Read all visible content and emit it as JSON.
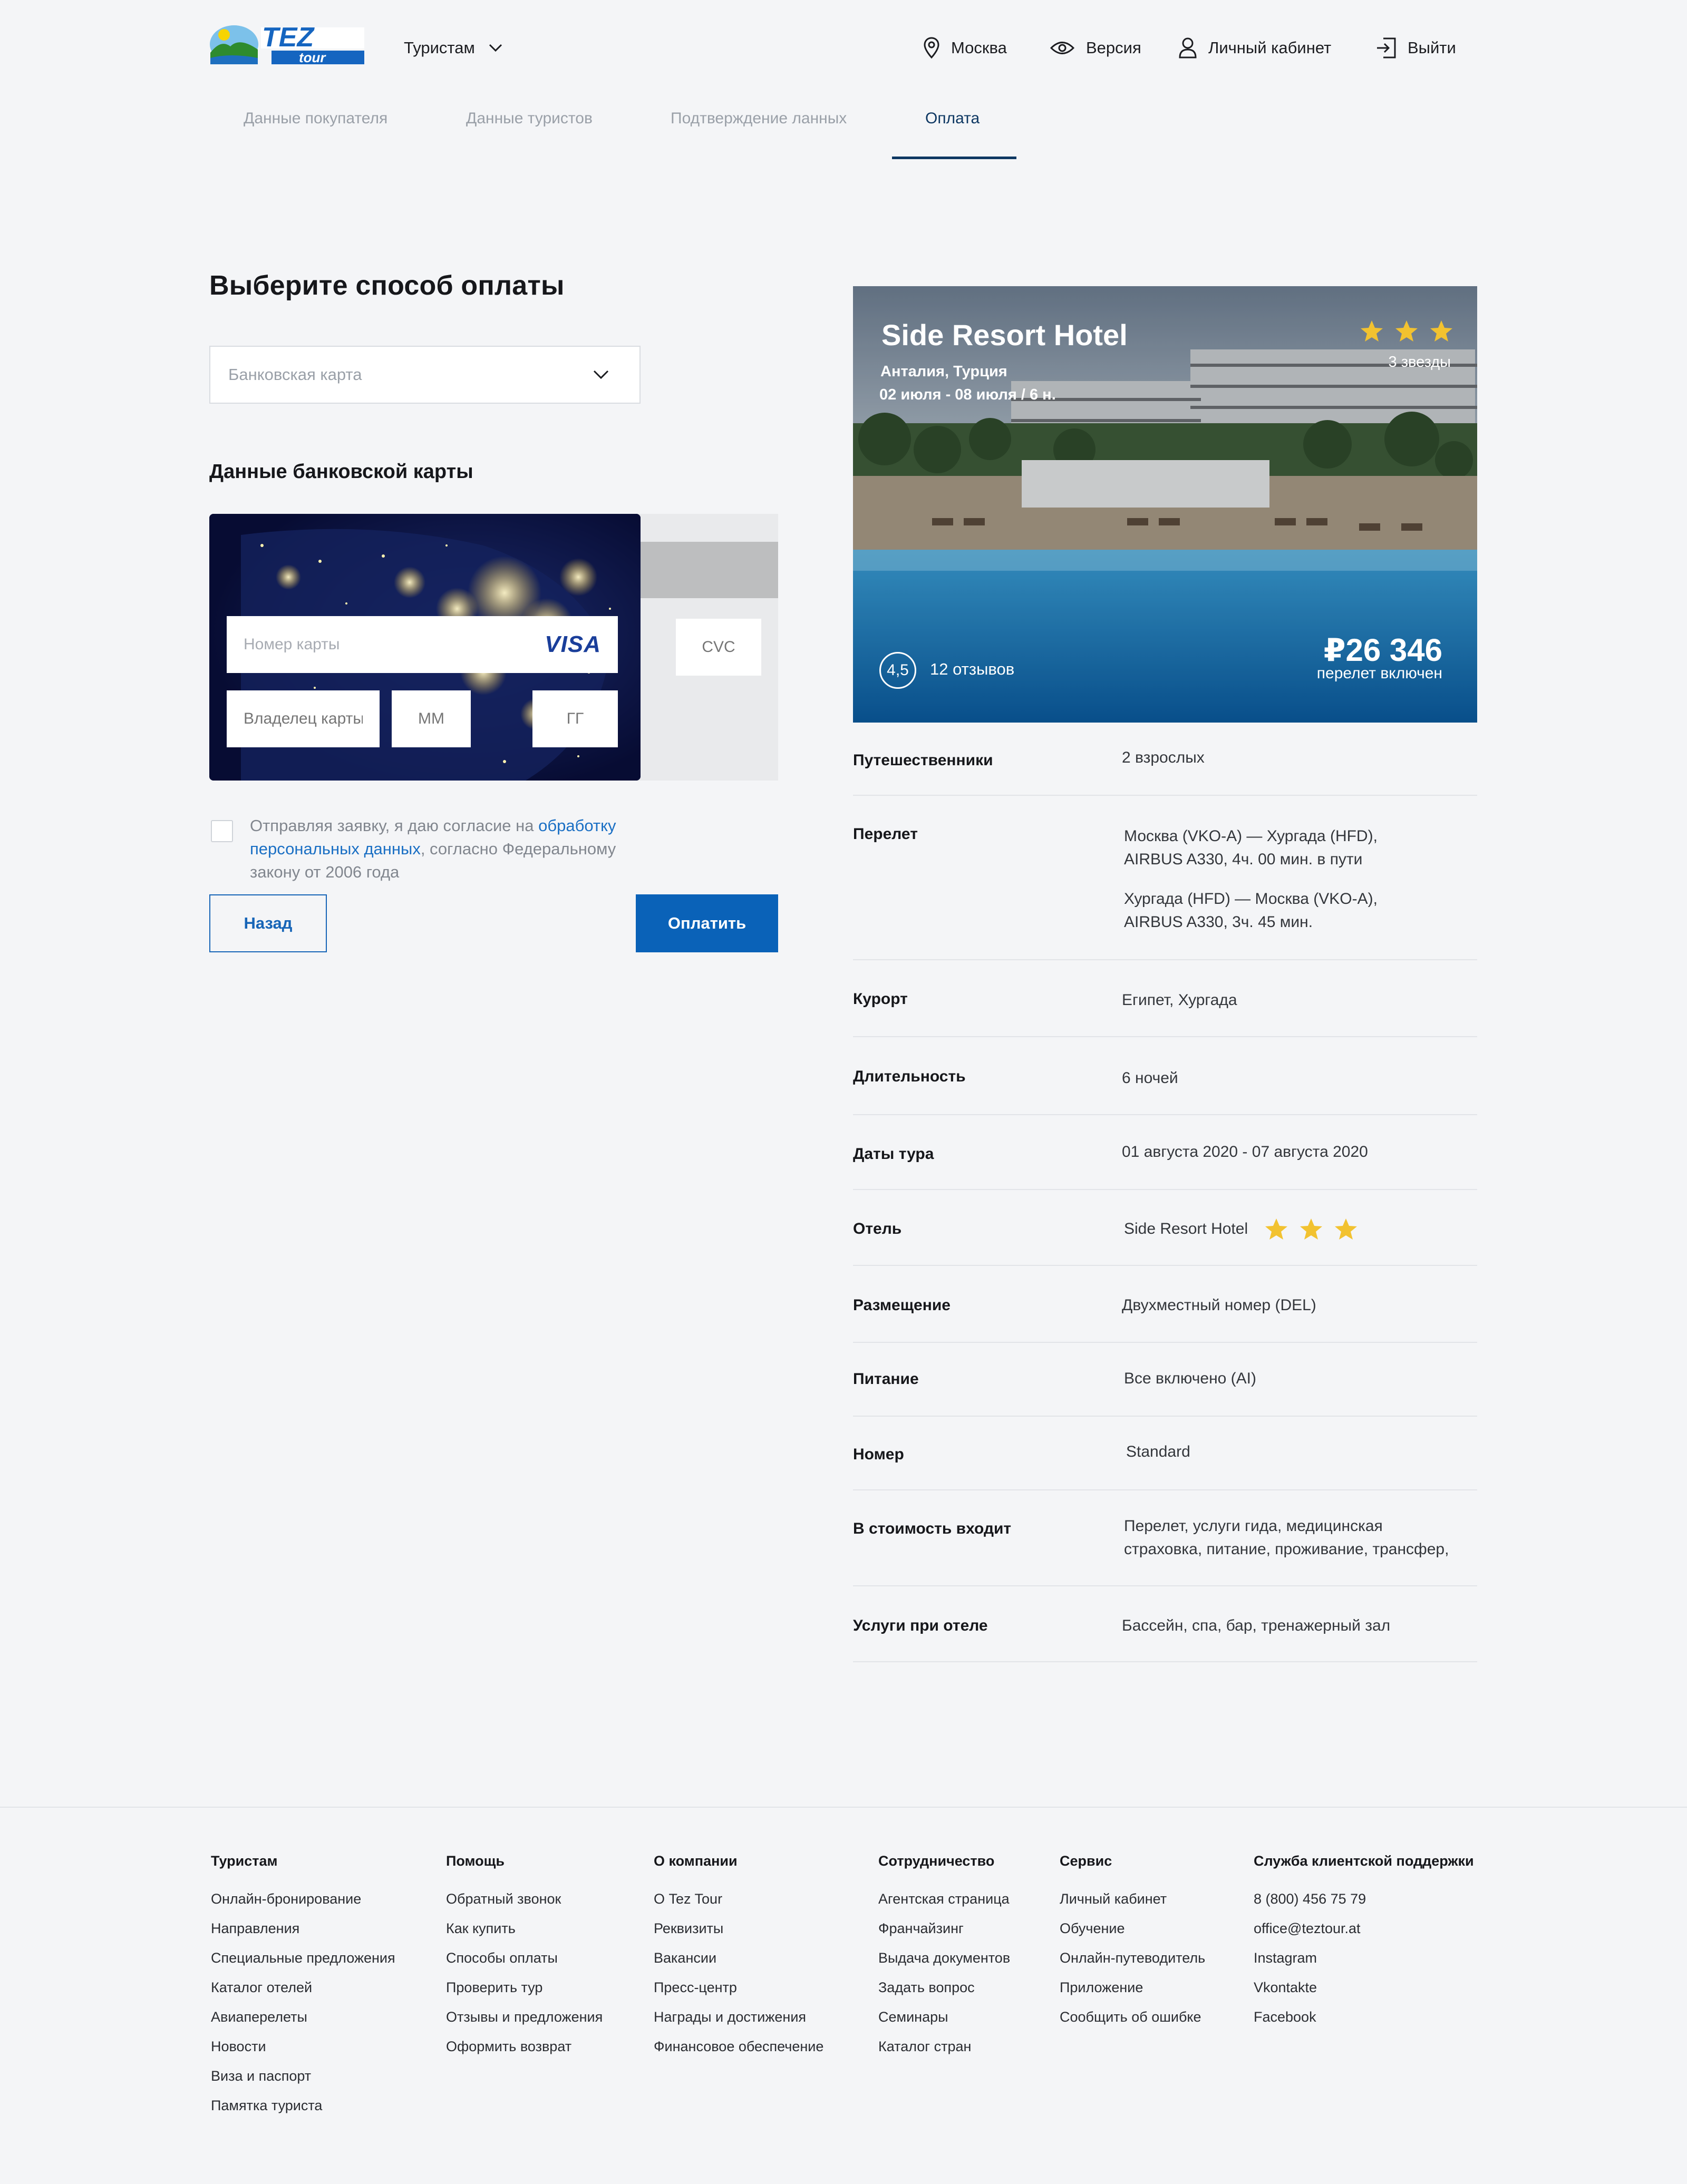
{
  "header": {
    "logo_text_top": "TEZ",
    "logo_text_bottom": "tour",
    "menu": "Туристам",
    "city": "Москва",
    "version": "Версия",
    "account": "Личный кабинет",
    "logout": "Выйти"
  },
  "steps": [
    {
      "label": "Данные покупателя"
    },
    {
      "label": "Данные туристов"
    },
    {
      "label": "Подтверждение ланных"
    },
    {
      "label": "Оплата"
    }
  ],
  "payment": {
    "title": "Выберите способ оплаты",
    "method_placeholder": "Банковская карта",
    "card_section_title": "Данные банковской карты",
    "card_number_placeholder": "Номер карты",
    "card_brand": "VISA",
    "holder_placeholder": "Владелец карты",
    "month_placeholder": "ММ",
    "year_placeholder": "ГГ",
    "cvc_placeholder": "CVC",
    "consent_text_before": "Отправляя заявку, я даю согласие на ",
    "consent_link": "обработку персональных данных",
    "consent_text_after": ", согласно Федеральному закону от 2006 года",
    "back_button": "Назад",
    "pay_button": "Оплатить"
  },
  "hotel": {
    "name": "Side Resort Hotel",
    "location": "Анталия, Турция",
    "dates": "02 июля - 08 июля / 6 н.",
    "stars": 3,
    "stars_label": "3 звезды",
    "rating": "4,5",
    "reviews": "12 отзывов",
    "price": "₽26 346",
    "price_note": "перелет включен"
  },
  "details": {
    "travelers": {
      "label": "Путешественники",
      "value": "2 взрослых"
    },
    "flight": {
      "label": "Перелет",
      "outbound_1": "Москва (VKO-A) — Хургада (HFD),",
      "outbound_2": "AIRBUS A330, 4ч. 00 мин. в пути",
      "return_1": "Хургада (HFD) — Москва (VKO-A),",
      "return_2": "AIRBUS A330, 3ч. 45 мин."
    },
    "resort": {
      "label": "Курорт",
      "value": "Египет, Хургада"
    },
    "duration": {
      "label": "Длительность",
      "value": "6 ночей"
    },
    "tour_dates": {
      "label": "Даты тура",
      "value": "01 августа 2020 - 07 августа 2020"
    },
    "hotel": {
      "label": "Отель",
      "value": "Side Resort Hotel",
      "stars": 3
    },
    "accommodation": {
      "label": "Размещение",
      "value": "Двухместный номер (DEL)"
    },
    "meals": {
      "label": "Питание",
      "value": "Все включено (AI)"
    },
    "room": {
      "label": "Номер",
      "value": "Standard"
    },
    "included": {
      "label": "В стоимость входит",
      "value_1": "Перелет, услуги гида, медицинская",
      "value_2": "страховка, питание, проживание, трансфер,"
    },
    "services": {
      "label": "Услуги при отеле",
      "value": "Бассейн, спа, бар, тренажерный зал"
    }
  },
  "footer": {
    "tourists": {
      "title": "Туристам",
      "items": [
        "Онлайн-бронирование",
        "Направления",
        "Специальные предложения",
        "Каталог отелей",
        "Авиаперелеты",
        "Новости",
        "Виза и паспорт",
        "Памятка туриста"
      ]
    },
    "help": {
      "title": "Помощь",
      "items": [
        "Обратный звонок",
        "Как купить",
        "Способы оплаты",
        "Проверить тур",
        "Отзывы и предложения",
        "Оформить возврат"
      ]
    },
    "company": {
      "title": "О компании",
      "items": [
        "О Tez Tour",
        "Реквизиты",
        "Вакансии",
        "Пресс-центр",
        "Награды и достижения",
        "Финансовое обеспечение"
      ]
    },
    "partners": {
      "title": "Сотрудничество",
      "items": [
        "Агентская страница",
        "Франчайзинг",
        "Выдача документов",
        "Задать вопрос",
        "Семинары",
        "Каталог стран"
      ]
    },
    "service": {
      "title": "Сервис",
      "items": [
        "Личный кабинет",
        "Обучение",
        "Онлайн-путеводитель",
        "Приложение",
        "Сообщить об ошибке"
      ]
    },
    "support": {
      "title": "Служба клиентской поддержки",
      "items": [
        "8 (800) 456 75 79",
        "office@teztour.at",
        "Instagram",
        "Vkontakte",
        "Facebook"
      ]
    }
  },
  "colors": {
    "accent": "#0a62b8",
    "dark_navy": "#0d3762",
    "star": "#f2c230",
    "background": "#f4f5f7"
  }
}
